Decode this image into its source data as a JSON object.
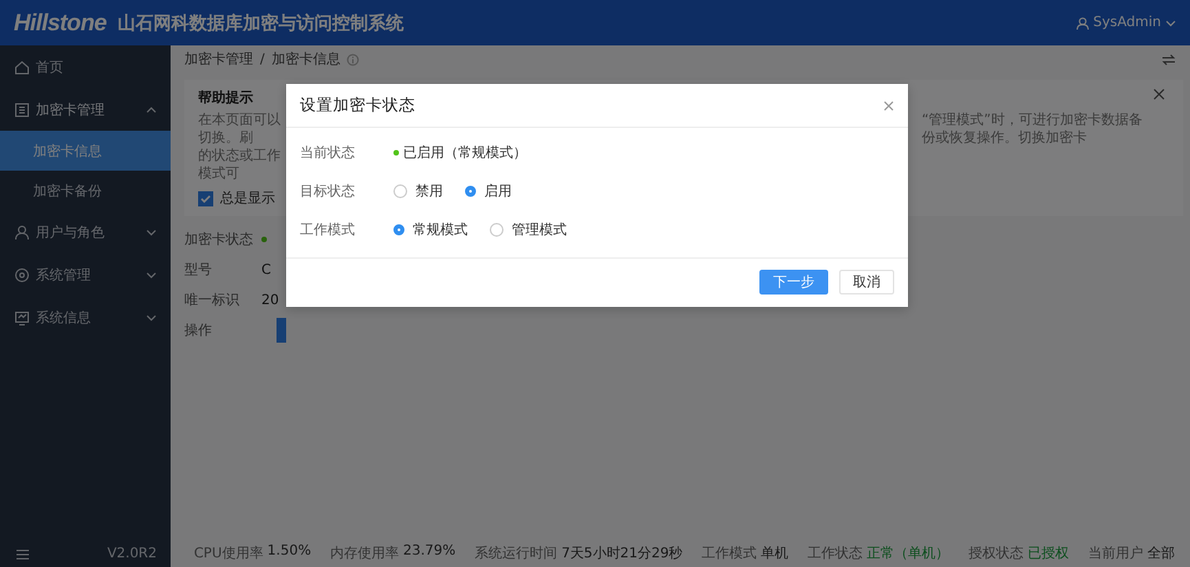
{
  "header": {
    "logo": "Hillstone",
    "title": "山石网科数据库加密与访问控制系统",
    "user": "SysAdmin"
  },
  "sidebar": {
    "items": [
      {
        "label": "首页",
        "kind": "link",
        "selected": false
      },
      {
        "label": "加密卡管理",
        "kind": "group",
        "expanded": true,
        "children": [
          {
            "label": "加密卡信息",
            "selected": true
          },
          {
            "label": "加密卡备份",
            "selected": false
          }
        ]
      },
      {
        "label": "用户与角色",
        "kind": "group",
        "expanded": false
      },
      {
        "label": "系统管理",
        "kind": "group",
        "expanded": false
      },
      {
        "label": "系统信息",
        "kind": "group",
        "expanded": false
      }
    ],
    "version": "V2.0R2"
  },
  "breadcrumb": {
    "items": [
      "加密卡管理",
      "加密卡信息"
    ],
    "separator": "/"
  },
  "help": {
    "title": "帮助提示",
    "text_left": [
      "在本页面可以切换。刷",
      "的状态或工作模式可"
    ],
    "text_right": "“管理模式”时，可进行加密卡数据备份或恢复操作。切换加密卡",
    "always_show": {
      "label": "总是显示",
      "checked": true
    }
  },
  "details": [
    {
      "label": "加密卡状态",
      "kind": "status"
    },
    {
      "label": "型号",
      "kind": "text",
      "value": "C"
    },
    {
      "label": "唯一标识",
      "kind": "text",
      "value": "20"
    },
    {
      "label": "操作",
      "kind": "button"
    }
  ],
  "dialog": {
    "title": "设置加密卡状态",
    "fields": [
      {
        "label": "当前状态",
        "kind": "status",
        "value": "已启用（常规模式）"
      },
      {
        "label": "目标状态",
        "kind": "radio",
        "options": [
          {
            "label": "禁用",
            "selected": false
          },
          {
            "label": "启用",
            "selected": true
          }
        ]
      },
      {
        "label": "工作模式",
        "kind": "radio",
        "options": [
          {
            "label": "常规模式",
            "selected": true
          },
          {
            "label": "管理模式",
            "selected": false
          }
        ]
      }
    ],
    "buttons": [
      {
        "label": "下一步",
        "kind": "primary"
      },
      {
        "label": "取消",
        "kind": "default"
      }
    ]
  },
  "status_bar": [
    {
      "label": "CPU使用率",
      "value": "1.50%",
      "kind": "plain"
    },
    {
      "label": "内存使用率",
      "value": "23.79%",
      "kind": "plain"
    },
    {
      "label": "系统运行时间",
      "value": "7天5小时21分29秒",
      "kind": "plain"
    },
    {
      "label": "工作模式",
      "value": "单机",
      "kind": "plain"
    },
    {
      "label": "工作状态",
      "value": "正常（单机）",
      "kind": "good"
    },
    {
      "label": "授权状态",
      "value": "已授权",
      "kind": "good"
    },
    {
      "label": "当前用户",
      "value": "全部",
      "kind": "plain"
    }
  ]
}
